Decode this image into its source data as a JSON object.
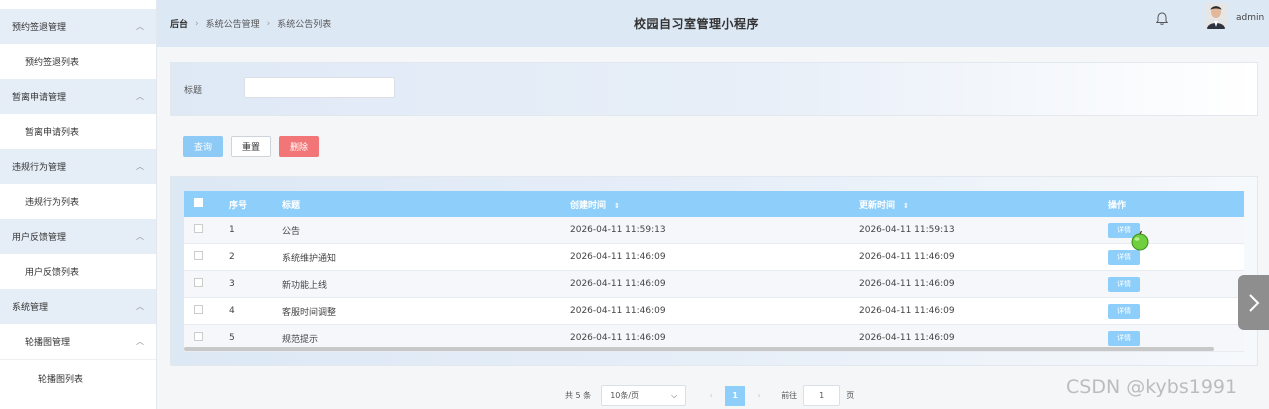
{
  "sidebar": {
    "groups": [
      {
        "label": "预约签退管理",
        "items": [
          "预约签退列表"
        ]
      },
      {
        "label": "暂离申请管理",
        "items": [
          "暂离申请列表"
        ]
      },
      {
        "label": "违规行为管理",
        "items": [
          "违规行为列表"
        ]
      },
      {
        "label": "用户反馈管理",
        "items": [
          "用户反馈列表"
        ]
      },
      {
        "label": "系统管理",
        "sub": {
          "label": "轮播图管理",
          "items": [
            "轮播图列表"
          ]
        }
      }
    ]
  },
  "header": {
    "breadcrumb": [
      "后台",
      "系统公告管理",
      "系统公告列表"
    ],
    "title": "校园自习室管理小程序",
    "username": "admin"
  },
  "search": {
    "label": "标题",
    "value": "",
    "placeholder": ""
  },
  "actions": {
    "query": "查询",
    "reset": "重置",
    "delete": "删除"
  },
  "table": {
    "columns": {
      "no": "序号",
      "title": "标题",
      "created": "创建时间",
      "updated": "更新时间",
      "op": "操作"
    },
    "rows": [
      {
        "no": "1",
        "title": "公告",
        "created": "2026-04-11 11:59:13",
        "updated": "2026-04-11 11:59:13",
        "op": "详情"
      },
      {
        "no": "2",
        "title": "系统维护通知",
        "created": "2026-04-11 11:46:09",
        "updated": "2026-04-11 11:46:09",
        "op": "详情"
      },
      {
        "no": "3",
        "title": "新功能上线",
        "created": "2026-04-11 11:46:09",
        "updated": "2026-04-11 11:46:09",
        "op": "详情"
      },
      {
        "no": "4",
        "title": "客服时间调整",
        "created": "2026-04-11 11:46:09",
        "updated": "2026-04-11 11:46:09",
        "op": "详情"
      },
      {
        "no": "5",
        "title": "规范提示",
        "created": "2026-04-11 11:46:09",
        "updated": "2026-04-11 11:46:09",
        "op": "详情"
      }
    ]
  },
  "pagination": {
    "total": "共 5 条",
    "page_size": "10条/页",
    "current": "1",
    "goto_label": "前往",
    "goto_value": "1",
    "page_suffix": "页"
  },
  "watermark": "CSDN @kybs1991",
  "colors": {
    "accent": "#8ecefa",
    "danger": "#f27677",
    "header_bg": "#dde8f5"
  }
}
